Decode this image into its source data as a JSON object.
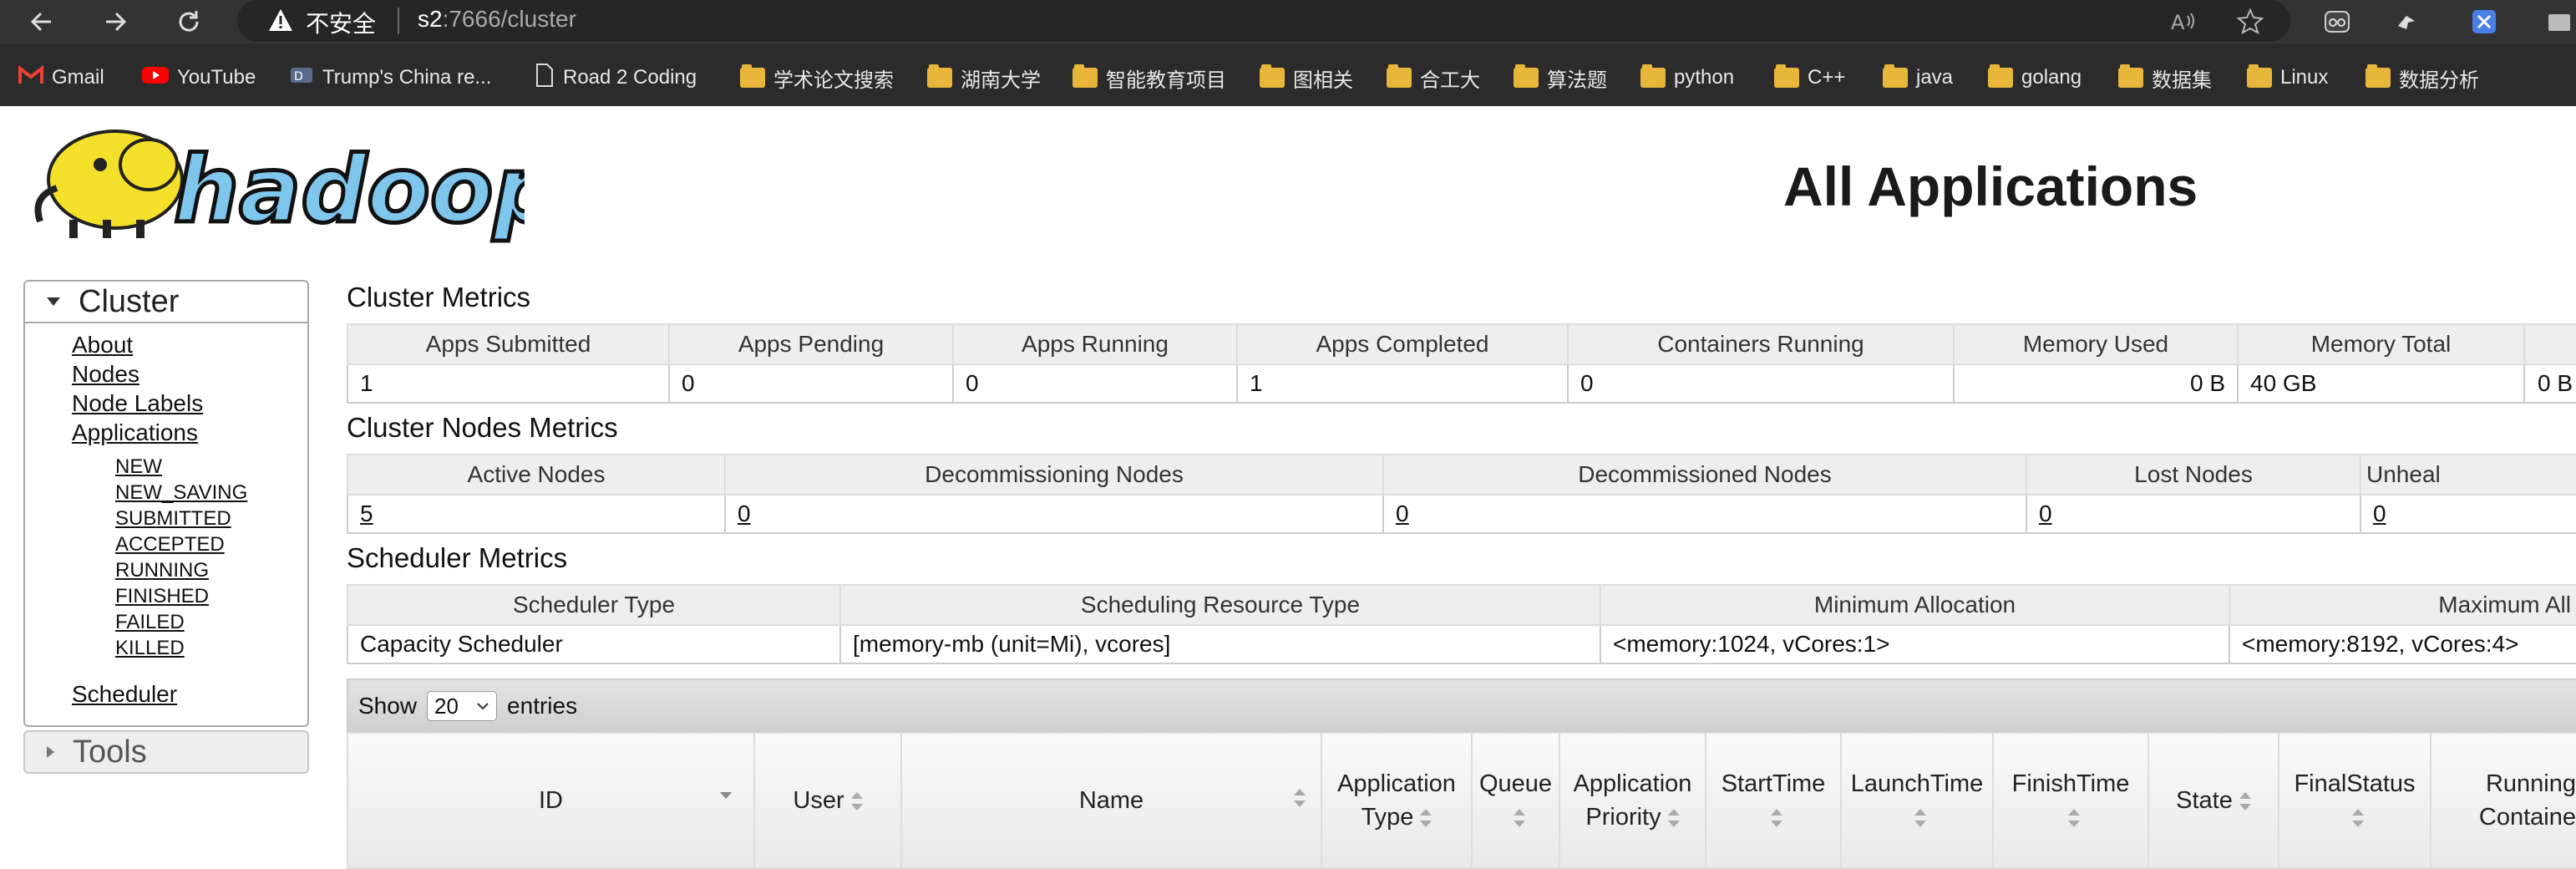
{
  "browser": {
    "insecure_label": "不安全",
    "url_host": "s2",
    "url_rest": ":7666/cluster",
    "bookmarks": [
      {
        "label": "Gmail",
        "icon": "gmail-icon"
      },
      {
        "label": "YouTube",
        "icon": "youtube-icon"
      },
      {
        "label": "Trump's China re...",
        "icon": "site-icon"
      },
      {
        "label": "Road 2 Coding",
        "icon": "page-icon"
      },
      {
        "label": "学术论文搜索",
        "icon": "folder-icon"
      },
      {
        "label": "湖南大学",
        "icon": "folder-icon"
      },
      {
        "label": "智能教育项目",
        "icon": "folder-icon"
      },
      {
        "label": "图相关",
        "icon": "folder-icon"
      },
      {
        "label": "合工大",
        "icon": "folder-icon"
      },
      {
        "label": "算法题",
        "icon": "folder-icon"
      },
      {
        "label": "python",
        "icon": "folder-icon"
      },
      {
        "label": "C++",
        "icon": "folder-icon"
      },
      {
        "label": "java",
        "icon": "folder-icon"
      },
      {
        "label": "golang",
        "icon": "folder-icon"
      },
      {
        "label": "数据集",
        "icon": "folder-icon"
      },
      {
        "label": "Linux",
        "icon": "folder-icon"
      },
      {
        "label": "数据分析",
        "icon": "folder-icon"
      }
    ]
  },
  "header": {
    "logo_text": "hadoop",
    "title": "All Applications"
  },
  "sidebar": {
    "cluster_label": "Cluster",
    "links": [
      "About",
      "Nodes",
      "Node Labels",
      "Applications"
    ],
    "app_states": [
      "NEW",
      "NEW_SAVING",
      "SUBMITTED",
      "ACCEPTED",
      "RUNNING",
      "FINISHED",
      "FAILED",
      "KILLED"
    ],
    "scheduler_label": "Scheduler",
    "tools_label": "Tools"
  },
  "cluster_metrics": {
    "title": "Cluster Metrics",
    "headers": [
      "Apps Submitted",
      "Apps Pending",
      "Apps Running",
      "Apps Completed",
      "Containers Running",
      "Memory Used",
      "Memory Total",
      ""
    ],
    "values": [
      "1",
      "0",
      "0",
      "1",
      "0",
      "0 B",
      "40 GB",
      "0 B"
    ]
  },
  "nodes_metrics": {
    "title": "Cluster Nodes Metrics",
    "headers": [
      "Active Nodes",
      "Decommissioning Nodes",
      "Decommissioned Nodes",
      "Lost Nodes",
      "Unheal"
    ],
    "values": [
      "5",
      "0",
      "0",
      "0",
      "0"
    ]
  },
  "scheduler_metrics": {
    "title": "Scheduler Metrics",
    "headers": [
      "Scheduler Type",
      "Scheduling Resource Type",
      "Minimum Allocation",
      "Maximum All"
    ],
    "values": [
      "Capacity Scheduler",
      "[memory-mb (unit=Mi), vcores]",
      "<memory:1024, vCores:1>",
      "<memory:8192, vCores:4>"
    ]
  },
  "entries": {
    "show_label": "Show",
    "count": "20",
    "entries_label": "entries"
  },
  "apps_table": {
    "columns": [
      {
        "line1": "ID",
        "line2": ""
      },
      {
        "line1": "User",
        "line2": ""
      },
      {
        "line1": "Name",
        "line2": ""
      },
      {
        "line1": "Application",
        "line2": "Type"
      },
      {
        "line1": "Queue",
        "line2": ""
      },
      {
        "line1": "Application",
        "line2": "Priority"
      },
      {
        "line1": "StartTime",
        "line2": ""
      },
      {
        "line1": "LaunchTime",
        "line2": ""
      },
      {
        "line1": "FinishTime",
        "line2": ""
      },
      {
        "line1": "State",
        "line2": ""
      },
      {
        "line1": "FinalStatus",
        "line2": ""
      },
      {
        "line1": "Running",
        "line2": "Containe"
      }
    ]
  }
}
